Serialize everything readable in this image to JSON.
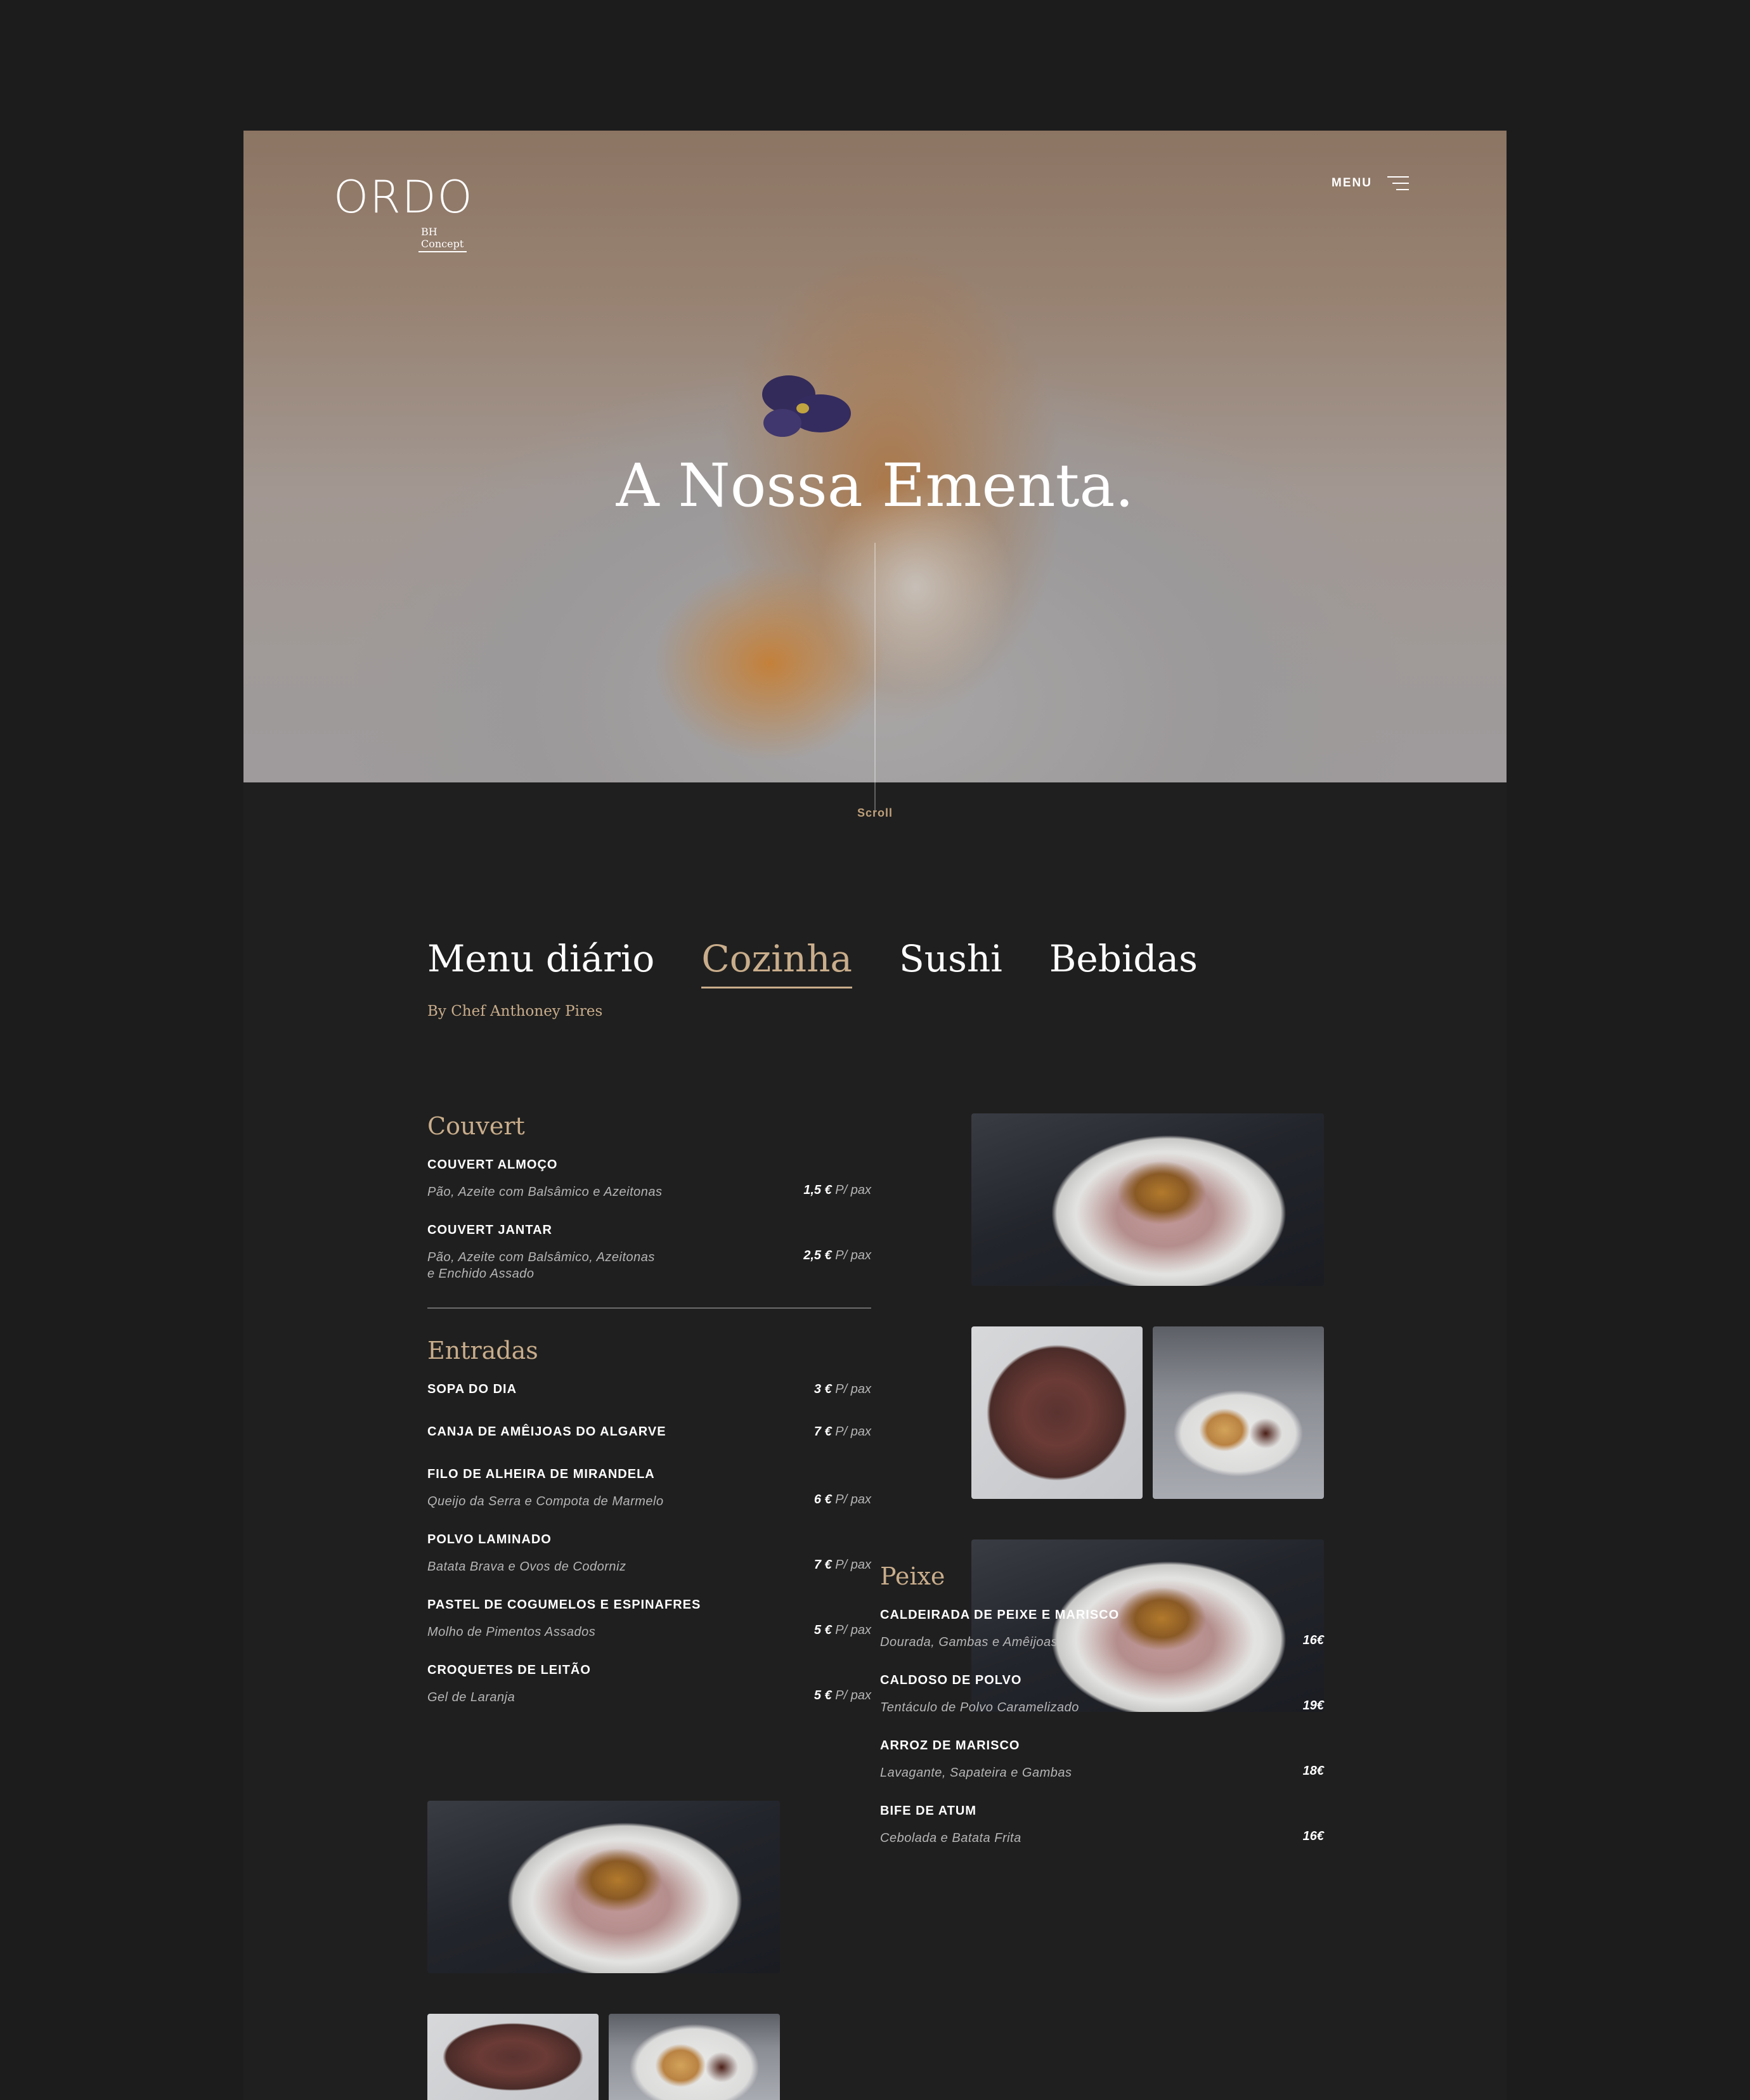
{
  "brand": {
    "logo_text": "ORDO",
    "logo_sub": "BH Concept"
  },
  "nav": {
    "menu_label": "MENU"
  },
  "hero": {
    "title": "A Nossa Ementa.",
    "scroll_label": "Scroll"
  },
  "tabs": [
    {
      "label": "Menu diário",
      "active": false
    },
    {
      "label": "Cozinha",
      "active": true
    },
    {
      "label": "Sushi",
      "active": false
    },
    {
      "label": "Bebidas",
      "active": false
    }
  ],
  "byline": "By Chef Anthoney Pires",
  "couvert": {
    "title": "Couvert",
    "items": [
      {
        "name": "COUVERT ALMOÇO",
        "desc": "Pão, Azeite com Balsâmico e Azeitonas",
        "price": "1,5 €",
        "unit": "P/ pax"
      },
      {
        "name": "COUVERT JANTAR",
        "desc": "Pão, Azeite com Balsâmico, Azeitonas",
        "desc2": "e Enchido Assado",
        "price": "2,5 €",
        "unit": "P/ pax"
      }
    ]
  },
  "entradas": {
    "title": "Entradas",
    "items": [
      {
        "name": "SOPA DO DIA",
        "desc": "",
        "price": "3 €",
        "unit": "P/ pax"
      },
      {
        "name": "CANJA DE AMÊIJOAS DO ALGARVE",
        "desc": "",
        "price": "7 €",
        "unit": "P/ pax"
      },
      {
        "name": "FILO DE ALHEIRA DE MIRANDELA",
        "desc": "Queijo da Serra e Compota de Marmelo",
        "price": "6 €",
        "unit": "P/ pax"
      },
      {
        "name": "POLVO LAMINADO",
        "desc": "Batata Brava e Ovos de Codorniz",
        "price": "7 €",
        "unit": "P/ pax"
      },
      {
        "name": "PASTEL DE COGUMELOS E ESPINAFRES",
        "desc": "Molho de Pimentos Assados",
        "price": "5 €",
        "unit": "P/ pax"
      },
      {
        "name": "CROQUETES DE LEITÃO",
        "desc": "Gel de Laranja",
        "price": "5 €",
        "unit": "P/ pax"
      }
    ]
  },
  "peixe": {
    "title": "Peixe",
    "items": [
      {
        "name": "CALDEIRADA DE PEIXE E MARISCO",
        "desc": "Dourada, Gambas e Amêijoas",
        "price": "16€"
      },
      {
        "name": "CALDOSO DE POLVO",
        "desc": "Tentáculo de Polvo Caramelizado",
        "price": "19€"
      },
      {
        "name": "ARROZ DE MARISCO",
        "desc": "Lavagante, Sapateira e Gambas",
        "price": "18€"
      },
      {
        "name": "BIFE DE ATUM",
        "desc": "Cebolada e Batata Frita",
        "price": "16€"
      }
    ]
  },
  "colors": {
    "accent": "#c9ad8b",
    "background": "#1f1f1f",
    "outer": "#1c1c1c"
  }
}
